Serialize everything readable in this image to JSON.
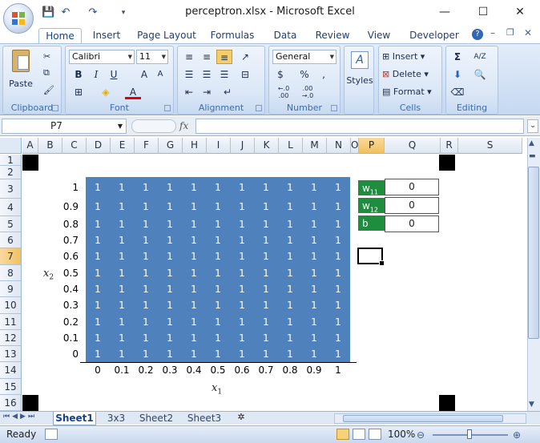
{
  "title": "perceptron.xlsx - Microsoft Excel",
  "window": {
    "minimize": "—",
    "maximize": "☐",
    "close": "✕"
  },
  "tabs": [
    "Home",
    "Insert",
    "Page Layout",
    "Formulas",
    "Data",
    "Review",
    "View",
    "Developer"
  ],
  "ribbon": {
    "clipboard": {
      "paste": "Paste",
      "label": "Clipboard"
    },
    "font": {
      "name": "Calibri",
      "size": "11",
      "bold": "B",
      "italic": "I",
      "underline": "U",
      "grow": "A",
      "shrink": "A",
      "fontcolor": "A",
      "label": "Font"
    },
    "alignment": {
      "label": "Alignment"
    },
    "number": {
      "format": "General",
      "currency": "$",
      "percent": "%",
      "comma": ",",
      "inc": "←.0 .00",
      "dec": ".00 →.0",
      "label": "Number"
    },
    "styles": {
      "label": "Styles"
    },
    "cells": {
      "insert": "Insert",
      "delete": "Delete",
      "format": "Format",
      "label": "Cells"
    },
    "editing": {
      "sum": "Σ",
      "sort": "A/Z",
      "label": "Editing"
    }
  },
  "formula_bar": {
    "namebox": "P7",
    "fx": "fx",
    "value": ""
  },
  "columns": [
    "A",
    "B",
    "C",
    "D",
    "E",
    "F",
    "G",
    "H",
    "I",
    "J",
    "K",
    "L",
    "M",
    "N",
    "O",
    "P",
    "Q",
    "R",
    "S"
  ],
  "rows": [
    "1",
    "2",
    "3",
    "4",
    "5",
    "6",
    "7",
    "8",
    "9",
    "10",
    "11",
    "12",
    "13",
    "14",
    "15",
    "16"
  ],
  "chart_data": {
    "type": "heatmap",
    "xlabel": "x",
    "xlabel_sub": "1",
    "ylabel": "x",
    "ylabel_sub": "2",
    "x": [
      "0",
      "0.1",
      "0.2",
      "0.3",
      "0.4",
      "0.5",
      "0.6",
      "0.7",
      "0.8",
      "0.9",
      "1"
    ],
    "y": [
      "1",
      "0.9",
      "0.8",
      "0.7",
      "0.6",
      "0.5",
      "0.4",
      "0.3",
      "0.2",
      "0.1",
      "0"
    ],
    "values": [
      [
        1,
        1,
        1,
        1,
        1,
        1,
        1,
        1,
        1,
        1,
        1
      ],
      [
        1,
        1,
        1,
        1,
        1,
        1,
        1,
        1,
        1,
        1,
        1
      ],
      [
        1,
        1,
        1,
        1,
        1,
        1,
        1,
        1,
        1,
        1,
        1
      ],
      [
        1,
        1,
        1,
        1,
        1,
        1,
        1,
        1,
        1,
        1,
        1
      ],
      [
        1,
        1,
        1,
        1,
        1,
        1,
        1,
        1,
        1,
        1,
        1
      ],
      [
        1,
        1,
        1,
        1,
        1,
        1,
        1,
        1,
        1,
        1,
        1
      ],
      [
        1,
        1,
        1,
        1,
        1,
        1,
        1,
        1,
        1,
        1,
        1
      ],
      [
        1,
        1,
        1,
        1,
        1,
        1,
        1,
        1,
        1,
        1,
        1
      ],
      [
        1,
        1,
        1,
        1,
        1,
        1,
        1,
        1,
        1,
        1,
        1
      ],
      [
        1,
        1,
        1,
        1,
        1,
        1,
        1,
        1,
        1,
        1,
        1
      ],
      [
        1,
        1,
        1,
        1,
        1,
        1,
        1,
        1,
        1,
        1,
        1
      ]
    ],
    "fill_color": "#4f81bd"
  },
  "weights": [
    {
      "label": "w",
      "sub": "11",
      "value": "0"
    },
    {
      "label": "w",
      "sub": "12",
      "value": "0"
    },
    {
      "label": "b",
      "sub": "",
      "value": "0"
    }
  ],
  "sheets": [
    "Sheet1",
    "3x3",
    "Sheet2",
    "Sheet3"
  ],
  "status": {
    "ready": "Ready",
    "zoom": "100%"
  }
}
